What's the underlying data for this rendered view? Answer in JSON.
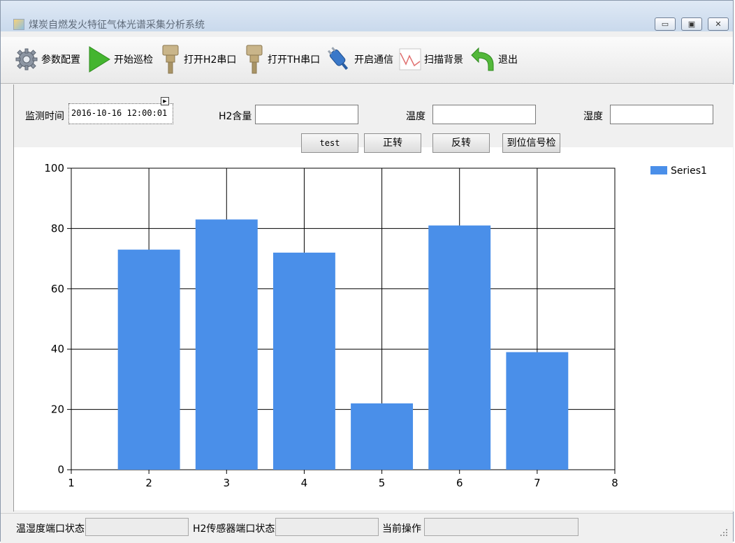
{
  "window": {
    "title": "煤炭自燃发火特征气体光谱采集分析系统",
    "controls": {
      "minimize": "▭",
      "maximize": "▣",
      "close": "✕"
    }
  },
  "toolbar": {
    "items": [
      {
        "label": "参数配置",
        "icon": "gear-icon"
      },
      {
        "label": "开始巡检",
        "icon": "play-icon"
      },
      {
        "label": "打开H2串口",
        "icon": "serial-port-icon"
      },
      {
        "label": "打开TH串口",
        "icon": "serial-port-icon"
      },
      {
        "label": "开启通信",
        "icon": "plug-icon"
      },
      {
        "label": "扫描背景",
        "icon": "spectrum-icon"
      },
      {
        "label": "退出",
        "icon": "exit-arrow-icon"
      }
    ]
  },
  "form": {
    "monitor_time_label": "监测时间",
    "monitor_time_value": "2016-10-16 12:00:01",
    "h2_label": "H2含量",
    "h2_value": "",
    "temperature_label": "温度",
    "temperature_value": "",
    "humidity_label": "湿度",
    "humidity_value": ""
  },
  "buttons": {
    "test": "test",
    "forward": "正转",
    "reverse": "反转",
    "position_check": "到位信号检"
  },
  "chart_data": {
    "type": "bar",
    "x": [
      2,
      3,
      4,
      5,
      6,
      7
    ],
    "series": [
      {
        "name": "Series1",
        "values": [
          73,
          83,
          72,
          22,
          81,
          39
        ],
        "color": "#4a8fe9"
      }
    ],
    "xlim": [
      1,
      8
    ],
    "ylim": [
      0,
      100
    ],
    "xticks": [
      1,
      2,
      3,
      4,
      5,
      6,
      7,
      8
    ],
    "yticks": [
      0,
      20,
      40,
      60,
      80,
      100
    ],
    "grid": true,
    "legend": "top-right"
  },
  "statusbar": {
    "th_port_label": "温湿度端口状态",
    "th_port_value": "",
    "h2_port_label": "H2传感器端口状态",
    "h2_port_value": "",
    "current_op_label": "当前操作",
    "current_op_value": ""
  }
}
